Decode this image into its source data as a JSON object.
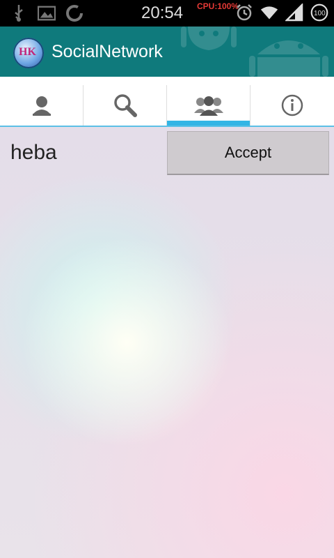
{
  "status_bar": {
    "time": "20:54",
    "cpu": "CPU:100%",
    "battery": "100"
  },
  "action_bar": {
    "app_title": "SocialNetwork",
    "logo_text": "HK"
  },
  "tabs": [
    {
      "icon": "person-icon",
      "selected": false
    },
    {
      "icon": "search-icon",
      "selected": false
    },
    {
      "icon": "group-icon",
      "selected": true
    },
    {
      "icon": "info-icon",
      "selected": false
    }
  ],
  "requests": [
    {
      "name": "heba",
      "accept_label": "Accept"
    }
  ],
  "colors": {
    "action_bar": "#0f7a7c",
    "tab_indicator": "#33b5e5",
    "button": "#cfcbcf"
  }
}
